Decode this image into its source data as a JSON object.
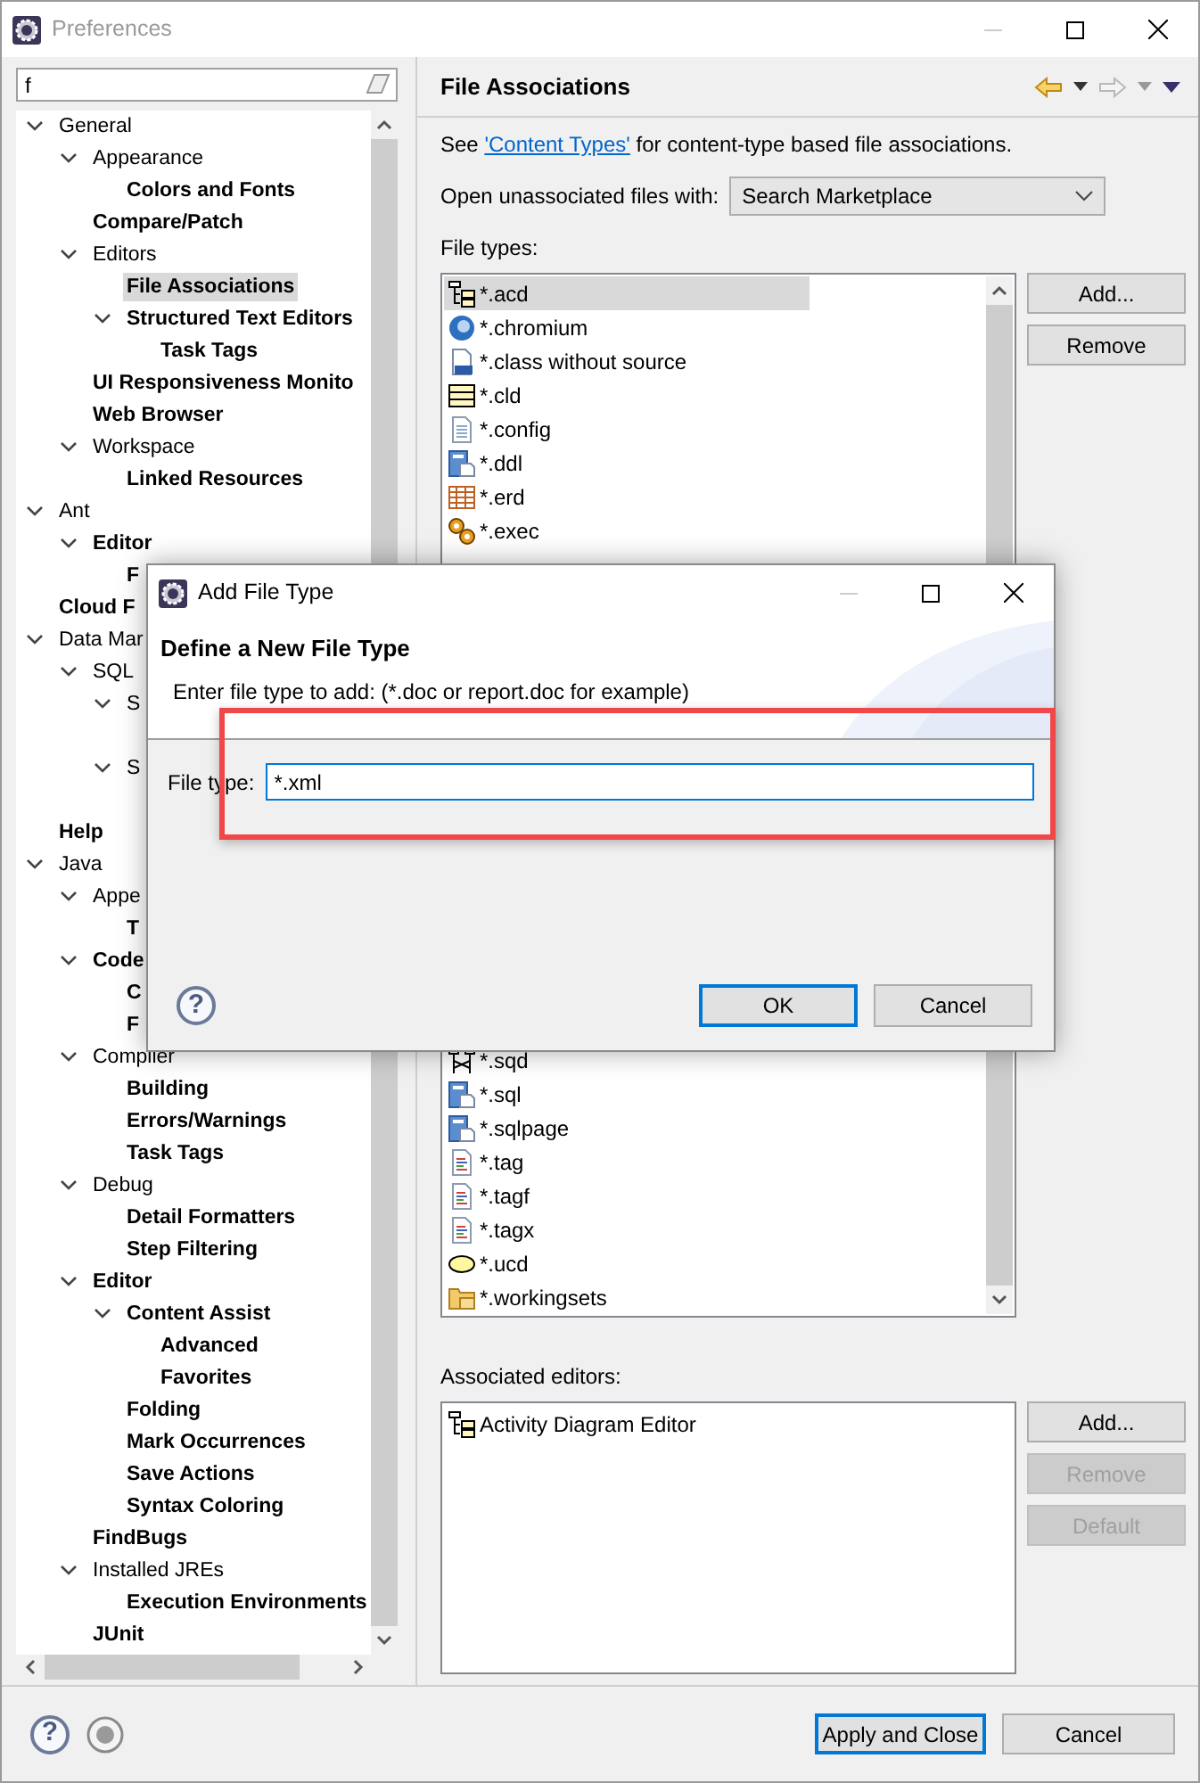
{
  "window": {
    "title": "Preferences",
    "active": false
  },
  "filter": {
    "value": "f"
  },
  "tree": [
    {
      "label": "General",
      "expanded": true,
      "match": false,
      "selected": false,
      "children": [
        {
          "label": "Appearance",
          "expanded": true,
          "match": false,
          "selected": false,
          "children": [
            {
              "label": "Colors and Fonts",
              "match": true,
              "selected": false
            }
          ]
        },
        {
          "label": "Compare/Patch",
          "match": true,
          "selected": false
        },
        {
          "label": "Editors",
          "expanded": true,
          "match": false,
          "selected": false,
          "children": [
            {
              "label": "File Associations",
              "match": true,
              "selected": true
            },
            {
              "label": "Structured Text Editors",
              "expanded": true,
              "match": true,
              "selected": false,
              "children": [
                {
                  "label": "Task Tags",
                  "match": true,
                  "selected": false
                }
              ]
            }
          ]
        },
        {
          "label": "UI Responsiveness Monito",
          "match": true,
          "selected": false
        },
        {
          "label": "Web Browser",
          "match": true,
          "selected": false
        },
        {
          "label": "Workspace",
          "expanded": true,
          "match": false,
          "selected": false,
          "children": [
            {
              "label": "Linked Resources",
              "match": true,
              "selected": false
            }
          ]
        }
      ]
    },
    {
      "label": "Ant",
      "expanded": true,
      "match": false,
      "selected": false,
      "children": [
        {
          "label": "Editor",
          "expanded": true,
          "match": true,
          "selected": false,
          "children": [
            {
              "label": "F",
              "match": true,
              "selected": false
            }
          ]
        }
      ]
    },
    {
      "label": "Cloud F",
      "match": true,
      "selected": false
    },
    {
      "label": "Data Mar",
      "expanded": true,
      "match": false,
      "selected": false,
      "children": [
        {
          "label": "SQL",
          "expanded": true,
          "match": false,
          "selected": false,
          "children": [
            {
              "label": "S",
              "expanded": true,
              "match": false,
              "selected": false
            },
            {
              "label": "S",
              "expanded": true,
              "match": false,
              "selected": false
            }
          ]
        }
      ]
    },
    {
      "label": "Help",
      "match": true,
      "selected": false
    },
    {
      "label": "Java",
      "expanded": true,
      "match": false,
      "selected": false,
      "children": [
        {
          "label": "Appe",
          "expanded": true,
          "match": false,
          "selected": false,
          "children": [
            {
              "label": "T",
              "match": true,
              "selected": false
            }
          ]
        },
        {
          "label": "Code",
          "expanded": true,
          "match": true,
          "selected": false,
          "children": [
            {
              "label": "C",
              "match": true,
              "selected": false
            },
            {
              "label": "F",
              "match": true,
              "selected": false
            }
          ]
        },
        {
          "label": "Compiler",
          "expanded": true,
          "match": false,
          "selected": false,
          "children": [
            {
              "label": "Building",
              "match": true,
              "selected": false
            },
            {
              "label": "Errors/Warnings",
              "match": true,
              "selected": false
            },
            {
              "label": "Task Tags",
              "match": true,
              "selected": false
            }
          ]
        },
        {
          "label": "Debug",
          "expanded": true,
          "match": false,
          "selected": false,
          "children": [
            {
              "label": "Detail Formatters",
              "match": true,
              "selected": false
            },
            {
              "label": "Step Filtering",
              "match": true,
              "selected": false
            }
          ]
        },
        {
          "label": "Editor",
          "expanded": true,
          "match": true,
          "selected": false,
          "children": [
            {
              "label": "Content Assist",
              "expanded": true,
              "match": true,
              "selected": false,
              "children": [
                {
                  "label": "Advanced",
                  "match": true,
                  "selected": false
                },
                {
                  "label": "Favorites",
                  "match": true,
                  "selected": false
                }
              ]
            },
            {
              "label": "Folding",
              "match": true,
              "selected": false
            },
            {
              "label": "Mark Occurrences",
              "match": true,
              "selected": false
            },
            {
              "label": "Save Actions",
              "match": true,
              "selected": false
            },
            {
              "label": "Syntax Coloring",
              "match": true,
              "selected": false
            }
          ]
        },
        {
          "label": "FindBugs",
          "match": true,
          "selected": false
        },
        {
          "label": "Installed JREs",
          "expanded": true,
          "match": false,
          "selected": false,
          "children": [
            {
              "label": "Execution Environments",
              "match": true,
              "selected": false
            }
          ]
        },
        {
          "label": "JUnit",
          "match": true,
          "selected": false
        }
      ]
    }
  ],
  "page": {
    "title": "File Associations",
    "nav": {
      "back_enabled": true,
      "forward_enabled": false
    },
    "info": {
      "before": "See ",
      "link": "'Content Types'",
      "after": " for content-type based file associations."
    },
    "unassociated": {
      "label": "Open unassociated files with:",
      "value": "Search Marketplace"
    },
    "file_types_label": "File types:",
    "file_types_top": [
      {
        "label": "*.acd",
        "kind": "flow",
        "selected": true
      },
      {
        "label": "*.chromium",
        "kind": "globe",
        "selected": false
      },
      {
        "label": "*.class without source",
        "kind": "binary",
        "selected": false
      },
      {
        "label": "*.cld",
        "kind": "lines",
        "selected": false
      },
      {
        "label": "*.config",
        "kind": "doc",
        "selected": false
      },
      {
        "label": "*.ddl",
        "kind": "dbdoc",
        "selected": false
      },
      {
        "label": "*.erd",
        "kind": "grid",
        "selected": false
      },
      {
        "label": "*.exec",
        "kind": "gears",
        "selected": false
      }
    ],
    "file_types_bottom": [
      {
        "label": "*.sqd",
        "kind": "network",
        "selected": false
      },
      {
        "label": "*.sql",
        "kind": "dbdoc",
        "selected": false
      },
      {
        "label": "*.sqlpage",
        "kind": "dbdoc",
        "selected": false
      },
      {
        "label": "*.tag",
        "kind": "colordoc",
        "selected": false
      },
      {
        "label": "*.tagf",
        "kind": "colordoc",
        "selected": false
      },
      {
        "label": "*.tagx",
        "kind": "colordoc",
        "selected": false
      },
      {
        "label": "*.ucd",
        "kind": "ellipse",
        "selected": false
      },
      {
        "label": "*.workingsets",
        "kind": "folder",
        "selected": false
      }
    ],
    "file_type_buttons": [
      {
        "label": "Add...",
        "disabled": false
      },
      {
        "label": "Remove",
        "disabled": false
      }
    ],
    "editors_label": "Associated editors:",
    "editors": [
      {
        "label": "Activity Diagram Editor",
        "kind": "flow",
        "selected": false
      }
    ],
    "editor_buttons": [
      {
        "label": "Add...",
        "disabled": false
      },
      {
        "label": "Remove",
        "disabled": true
      },
      {
        "label": "Default",
        "disabled": true
      }
    ]
  },
  "footer": {
    "help": "?",
    "buttons": [
      {
        "label": "Apply and Close",
        "default": true
      },
      {
        "label": "Cancel",
        "default": false
      }
    ]
  },
  "dialog": {
    "title": "Add File Type",
    "heading": "Define a New File Type",
    "description": "Enter file type to add: (*.doc or report.doc for example)",
    "field": {
      "label": "File type:",
      "value": "*.xml",
      "highlighted": true
    },
    "help": "?",
    "buttons": [
      {
        "label": "OK",
        "default": true
      },
      {
        "label": "Cancel",
        "default": false
      }
    ]
  }
}
